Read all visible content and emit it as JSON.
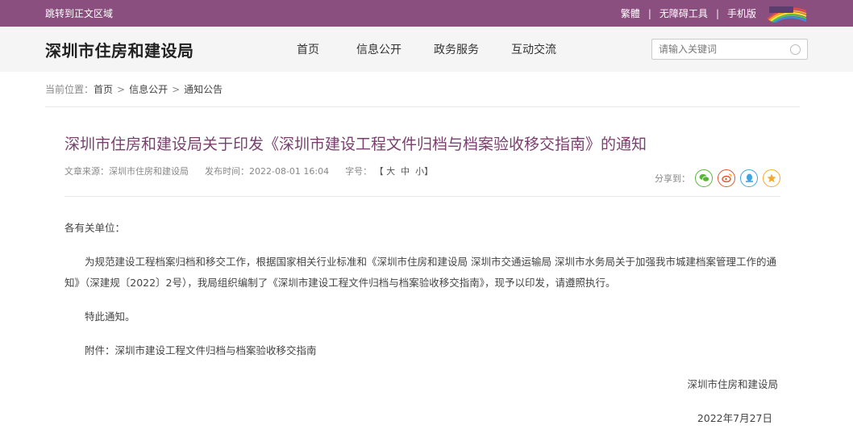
{
  "topbar": {
    "skip_link": "跳转到正文区域",
    "traditional": "繁體",
    "accessibility": "无障碍工具",
    "mobile": "手机版",
    "separator": "|"
  },
  "header": {
    "site_title": "深圳市住房和建设局",
    "nav": [
      "首页",
      "信息公开",
      "政务服务",
      "互动交流"
    ],
    "search_placeholder": "请输入关键词"
  },
  "breadcrumb": {
    "label": "当前位置：",
    "items": [
      "首页",
      "信息公开",
      "通知公告"
    ],
    "separator": ">"
  },
  "article": {
    "title": "深圳市住房和建设局关于印发《深圳市建设工程文件归档与档案验收移交指南》的通知",
    "source": "文章来源：深圳市住房和建设局",
    "published": "发布时间：2022-08-01 16:04",
    "font_size_label": "字号：",
    "font_size_options": "【 大  中  小】",
    "share_label": "分享到：",
    "share_icons": [
      "wechat-icon",
      "weibo-icon",
      "qq-icon",
      "favorite-icon"
    ],
    "greeting": "各有关单位：",
    "paragraph1": "为规范建设工程档案归档和移交工作，根据国家相关行业标准和《深圳市住房和建设局 深圳市交通运输局 深圳市水务局关于加强我市城建档案管理工作的通知》（深建规〔2022〕2号），我局组织编制了《深圳市建设工程文件归档与档案验收移交指南》，现予以印发，请遵照执行。",
    "paragraph2": "特此通知。",
    "attachment": "附件：深圳市建设工程文件归档与档案验收移交指南",
    "signature": "深圳市住房和建设局",
    "date": "2022年7月27日"
  },
  "colors": {
    "topbar_bg": "#8b4f7f",
    "title_color": "#7a3f6f"
  }
}
